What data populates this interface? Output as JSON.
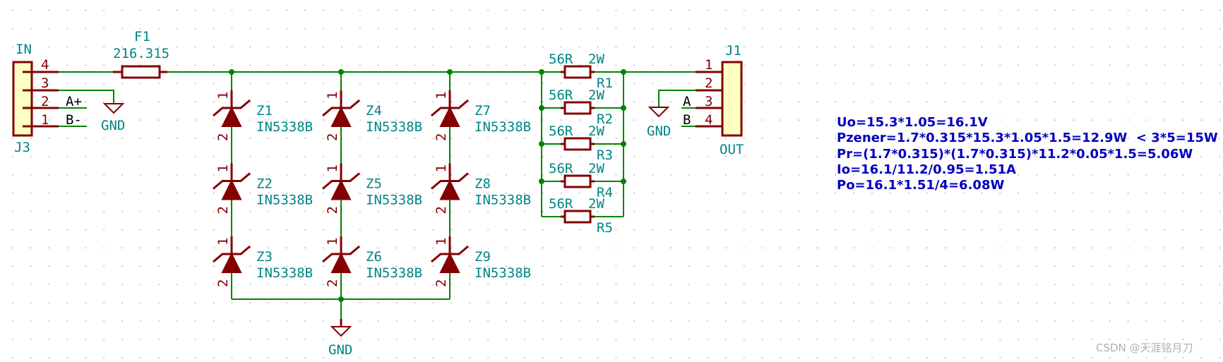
{
  "colors": {
    "wire": "#008400",
    "component": "#840000",
    "label_text": "#008484",
    "note_text": "#0000c0",
    "connector_fill": "#ffffc2"
  },
  "input_connector": {
    "ref": "J3",
    "value": "IN",
    "pins": [
      "4",
      "3",
      "2",
      "1"
    ],
    "net_labels": {
      "pin2": "A+",
      "pin1": "B-"
    },
    "gnd": "GND"
  },
  "fuse": {
    "ref": "F1",
    "value": "216.315"
  },
  "zeners": [
    {
      "ref": "Z1",
      "value": "IN5338B"
    },
    {
      "ref": "Z2",
      "value": "IN5338B"
    },
    {
      "ref": "Z3",
      "value": "IN5338B"
    },
    {
      "ref": "Z4",
      "value": "IN5338B"
    },
    {
      "ref": "Z5",
      "value": "IN5338B"
    },
    {
      "ref": "Z6",
      "value": "IN5338B"
    },
    {
      "ref": "Z7",
      "value": "IN5338B"
    },
    {
      "ref": "Z8",
      "value": "IN5338B"
    },
    {
      "ref": "Z9",
      "value": "IN5338B"
    }
  ],
  "zener_pins": [
    "1",
    "2"
  ],
  "zener_gnd": "GND",
  "resistors": [
    {
      "ref": "R1",
      "value": "56R",
      "power": "2W"
    },
    {
      "ref": "R2",
      "value": "56R",
      "power": "2W"
    },
    {
      "ref": "R3",
      "value": "56R",
      "power": "2W"
    },
    {
      "ref": "R4",
      "value": "56R",
      "power": "2W"
    },
    {
      "ref": "R5",
      "value": "56R",
      "power": "2W"
    }
  ],
  "output_connector": {
    "ref": "J1",
    "value": "OUT",
    "pins": [
      "1",
      "2",
      "3",
      "4"
    ],
    "net_labels": {
      "pin3": "A",
      "pin4": "B"
    },
    "gnd": "GND"
  },
  "notes": [
    "Uo=15.3*1.05=16.1V",
    "Pzener=1.7*0.315*15.3*1.05*1.5=12.9W  < 3*5=15W",
    "Pr=(1.7*0.315)*(1.7*0.315)*11.2*0.05*1.5=5.06W",
    "Io=16.1/11.2/0.95=1.51A",
    "Po=16.1*1.51/4=6.08W"
  ],
  "watermark": "CSDN @天涯铭月刀"
}
